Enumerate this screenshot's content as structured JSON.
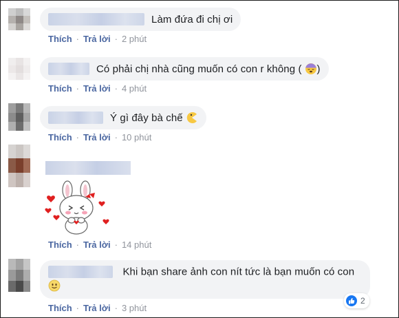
{
  "comments": [
    {
      "text": "Làm đứa đi chị ơi",
      "actions": {
        "like": "Thích",
        "reply": "Trả lời",
        "time": "2 phút"
      },
      "emoji": null
    },
    {
      "text": "Có phải chị nhà cũng muốn có con r không (",
      "text_suffix": ")",
      "actions": {
        "like": "Thích",
        "reply": "Trả lời",
        "time": "4 phút"
      },
      "emoji": "sleepy-face-icon"
    },
    {
      "text": "Ý gì đây bà chế",
      "actions": {
        "like": "Thích",
        "reply": "Trả lời",
        "time": "10 phút"
      },
      "emoji": "pacman-icon"
    },
    {
      "text": "",
      "sticker": "bunny-blushing-sticker",
      "actions": {
        "like": "Thích",
        "reply": "Trả lời",
        "time": "14 phút"
      }
    },
    {
      "text": "Khi bạn share ảnh con nít tức là bạn muốn có con",
      "actions": {
        "like": "Thích",
        "reply": "Trả lời",
        "time": "3 phút"
      },
      "emoji": "smiley-icon",
      "reaction": {
        "icon": "like-icon",
        "count": "2",
        "color": "#1877f2"
      }
    }
  ],
  "colors": {
    "link": "#4b67a1",
    "muted": "#90949c",
    "bubble": "#f2f3f5",
    "text": "#1c1e21"
  }
}
